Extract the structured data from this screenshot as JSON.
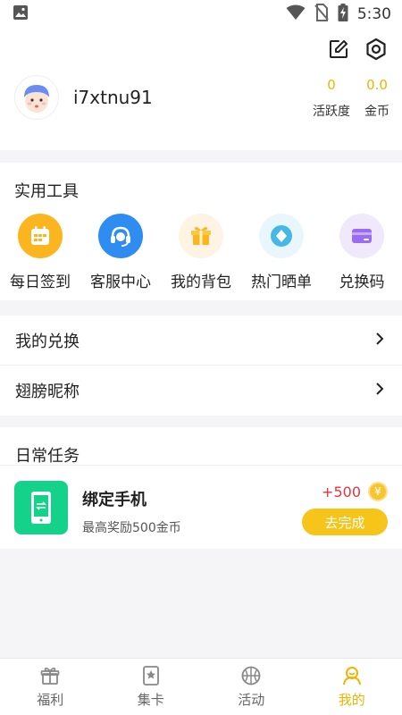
{
  "status_bar": {
    "time": "5:30"
  },
  "profile": {
    "username": "i7xtnu91",
    "stats": [
      {
        "value": "0",
        "label": "活跃度"
      },
      {
        "value": "0.0",
        "label": "金币"
      }
    ]
  },
  "tools": {
    "title": "实用工具",
    "items": [
      {
        "label": "每日签到",
        "icon": "calendar-icon",
        "bg": "#fbb51e"
      },
      {
        "label": "客服中心",
        "icon": "headset-icon",
        "bg": "#2f8cf0"
      },
      {
        "label": "我的背包",
        "icon": "gift-icon",
        "bg": "#fff3e3"
      },
      {
        "label": "热门晒单",
        "icon": "diamond-icon",
        "bg": "#e9f6fb"
      },
      {
        "label": "兑换码",
        "icon": "card-icon",
        "bg": "#efe9fb"
      }
    ]
  },
  "menu": [
    {
      "label": "我的兑换"
    },
    {
      "label": "翅膀昵称"
    }
  ],
  "tasks": {
    "title": "日常任务",
    "items": [
      {
        "name": "绑定手机",
        "desc": "最高奖励500金币",
        "reward": "+500",
        "coin": "¥",
        "button": "去完成"
      }
    ]
  },
  "tabbar": [
    {
      "label": "福利",
      "icon": "gift-tab-icon",
      "active": false
    },
    {
      "label": "集卡",
      "icon": "card-tab-icon",
      "active": false
    },
    {
      "label": "活动",
      "icon": "basketball-tab-icon",
      "active": false
    },
    {
      "label": "我的",
      "icon": "user-tab-icon",
      "active": true
    }
  ],
  "colors": {
    "accent": "#f0b400",
    "reward": "#e8343c",
    "task_icon": "#14d28a"
  }
}
